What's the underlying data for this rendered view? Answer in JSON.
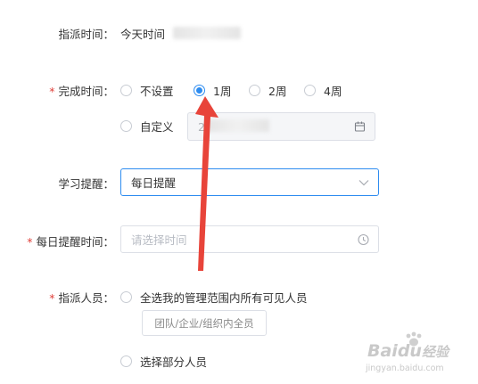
{
  "assign_time": {
    "label": "指派时间：",
    "value": "今天时间"
  },
  "complete_time": {
    "required_mark": "*",
    "label": "完成时间：",
    "options": [
      "不设置",
      "1周",
      "2周",
      "4周"
    ],
    "selected": "1周",
    "custom_label": "自定义",
    "custom_date_partial": "2"
  },
  "study_reminder": {
    "label": "学习提醒：",
    "value": "每日提醒"
  },
  "daily_reminder_time": {
    "required_mark": "*",
    "label": "每日提醒时间：",
    "placeholder": "请选择时间"
  },
  "assignee": {
    "required_mark": "*",
    "label": "指派人员：",
    "option_all": "全选我的管理范围内所有可见人员",
    "tag_all": "团队/企业/组织内全员",
    "option_partial": "选择部分人员"
  },
  "watermark": {
    "brand": "Baidu",
    "brand_cn": "经验",
    "url": "jingyan.baidu.com"
  },
  "colors": {
    "accent": "#2d8cf0",
    "required": "#e0403a",
    "arrow": "#e8443a"
  }
}
